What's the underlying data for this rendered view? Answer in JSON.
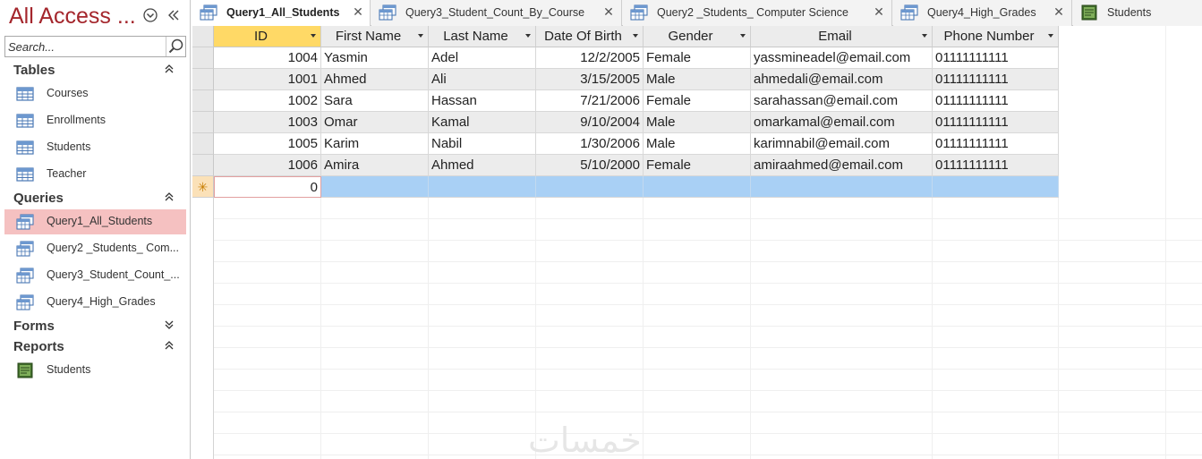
{
  "nav": {
    "title": "All Access ...",
    "search_placeholder": "Search...",
    "groups": {
      "tables": {
        "label": "Tables",
        "chevron": "up",
        "items": [
          {
            "label": "Courses",
            "icon": "table-icon"
          },
          {
            "label": "Enrollments",
            "icon": "table-icon"
          },
          {
            "label": "Students",
            "icon": "table-icon"
          },
          {
            "label": "Teacher",
            "icon": "table-icon"
          }
        ]
      },
      "queries": {
        "label": "Queries",
        "chevron": "up",
        "items": [
          {
            "label": "Query1_All_Students",
            "icon": "query-icon",
            "selected": true
          },
          {
            "label": "Query2 _Students_ Com...",
            "icon": "query-icon"
          },
          {
            "label": "Query3_Student_Count_...",
            "icon": "query-icon"
          },
          {
            "label": "Query4_High_Grades",
            "icon": "query-icon"
          }
        ]
      },
      "forms": {
        "label": "Forms",
        "chevron": "down"
      },
      "reports": {
        "label": "Reports",
        "chevron": "up",
        "items": [
          {
            "label": "Students",
            "icon": "report-icon"
          }
        ]
      }
    }
  },
  "tabs": [
    {
      "label": "Query1_All_Students",
      "icon": "query-icon",
      "active": true
    },
    {
      "label": "Query3_Student_Count_By_Course",
      "icon": "query-icon"
    },
    {
      "label": "Query2 _Students_ Computer Science",
      "icon": "query-icon"
    },
    {
      "label": "Query4_High_Grades",
      "icon": "query-icon"
    },
    {
      "label": "Students",
      "icon": "report-icon"
    }
  ],
  "sheet": {
    "columns": [
      "ID",
      "First Name",
      "Last Name",
      "Date Of Birth",
      "Gender",
      "Email",
      "Phone Number"
    ],
    "rows": [
      [
        "1004",
        "Yasmin",
        "Adel",
        "12/2/2005",
        "Female",
        "yassmineadel@email.com",
        "01111111111"
      ],
      [
        "1001",
        "Ahmed",
        "Ali",
        "3/15/2005",
        "Male",
        "ahmedali@email.com",
        "01111111111"
      ],
      [
        "1002",
        "Sara",
        "Hassan",
        "7/21/2006",
        "Female",
        "sarahassan@email.com",
        "01111111111"
      ],
      [
        "1003",
        "Omar",
        "Kamal",
        "9/10/2004",
        "Male",
        "omarkamal@email.com",
        "01111111111"
      ],
      [
        "1005",
        "Karim",
        "Nabil",
        "1/30/2006",
        "Male",
        "karimnabil@email.com",
        "01111111111"
      ],
      [
        "1006",
        "Amira",
        "Ahmed",
        "5/10/2000",
        "Female",
        "amiraahmed@email.com",
        "01111111111"
      ]
    ],
    "new_row": {
      "marker": "✳",
      "id_default": "0"
    }
  },
  "watermark": "خمسات",
  "colors": {
    "title_red": "#a4262c",
    "selected_nav": "#f5c1c1",
    "id_header": "#ffd966",
    "new_row_blue": "#a9d0f5",
    "alt_row": "#ececec"
  }
}
